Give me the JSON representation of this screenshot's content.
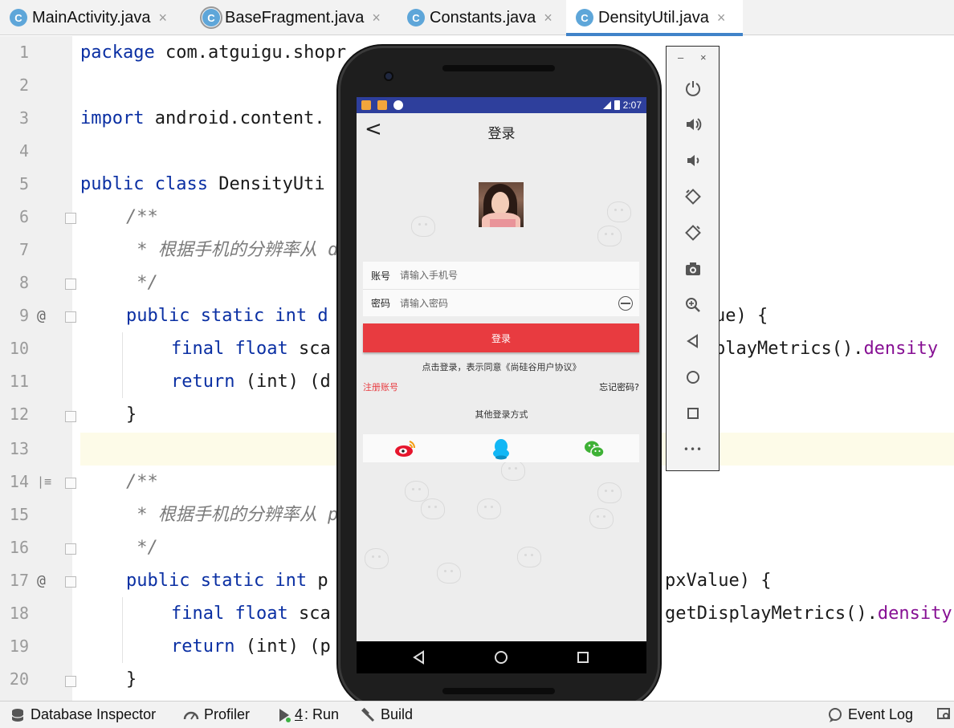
{
  "tabs": [
    {
      "label": "MainActivity.java",
      "active": false
    },
    {
      "label": "BaseFragment.java",
      "active": false
    },
    {
      "label": "Constants.java",
      "active": false
    },
    {
      "label": "DensityUtil.java",
      "active": true
    }
  ],
  "tab_icon_letter": "C",
  "tab_close_glyph": "×",
  "editor": {
    "line_numbers": [
      "1",
      "2",
      "3",
      "4",
      "5",
      "6",
      "7",
      "8",
      "9",
      "10",
      "11",
      "12",
      "13",
      "14",
      "15",
      "16",
      "17",
      "18",
      "19",
      "20"
    ],
    "gutter_marks": {
      "override": "@",
      "structure": "|≡"
    },
    "code": {
      "l1_kw": "package",
      "l1_rest": " com.atguigu.shopr",
      "l3_kw": "import",
      "l3_rest": " android.content.",
      "l5_kw": "public class",
      "l5_rest": " DensityUti",
      "l6": "/**",
      "l7": " * 根据手机的分辨率从 d",
      "l8": " */",
      "l9_kw": "public static int",
      "l9_rest": " d",
      "l9_tail": "ue) {",
      "l10_kw": "final float",
      "l10_rest": " sca",
      "l10_tail": "playMetrics().",
      "l10_prop": "density",
      "l11_kw": "return",
      "l11_rest": " (int) (d",
      "l12": "}",
      "l14": "/**",
      "l15": " * 根据手机的分辨率从 p",
      "l16": " */",
      "l17_kw": "public static int",
      "l17_rest": " p",
      "l17_tail": "pxValue) {",
      "l18_kw": "final float",
      "l18_rest": " sca",
      "l18_tail": "getDisplayMetrics().",
      "l18_prop": "density",
      "l19_kw": "return",
      "l19_rest": " (int) (p",
      "l20": "}"
    }
  },
  "phone": {
    "status_time": "2:07",
    "title": "登录",
    "back_glyph": "<",
    "account_label": "账号",
    "account_placeholder": "请输入手机号",
    "password_label": "密码",
    "password_placeholder": "请输入密码",
    "login_button": "登录",
    "agreement": "点击登录，表示同意《尚硅谷用户协议》",
    "register": "注册账号",
    "forgot": "忘记密码?",
    "other_login": "其他登录方式",
    "social": [
      "weibo-icon",
      "qq-icon",
      "wechat-icon"
    ]
  },
  "emulator_toolbar": {
    "minimize": "–",
    "close": "×",
    "buttons": [
      "power-icon",
      "volume-up-icon",
      "volume-down-icon",
      "rotate-left-icon",
      "rotate-right-icon",
      "camera-icon",
      "zoom-icon",
      "back-icon",
      "home-icon",
      "overview-icon",
      "more-icon"
    ],
    "more_glyph": "•••"
  },
  "bottom_bar": {
    "database_inspector": "Database Inspector",
    "profiler": "Profiler",
    "run_number": "4",
    "run_label": ": Run",
    "build": "Build",
    "event_log": "Event Log"
  },
  "colors": {
    "keyword": "#0a2fa3",
    "comment": "#7a7a7a",
    "property": "#871094",
    "tab_accent": "#4083c9",
    "phone_status": "#2e3f9c",
    "login_red": "#e83b40"
  }
}
